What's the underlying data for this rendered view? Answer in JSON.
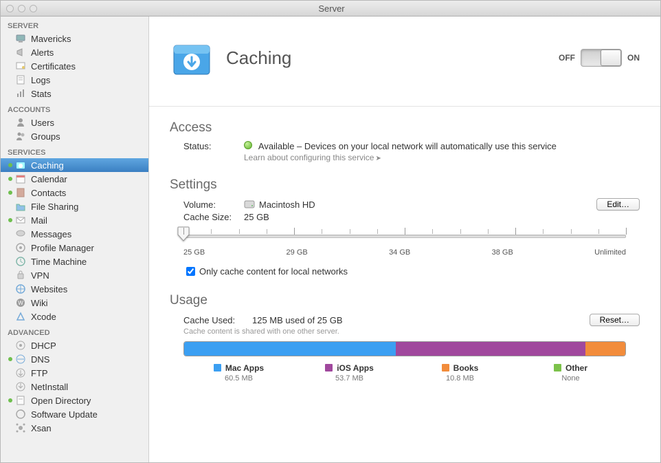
{
  "window": {
    "title": "Server"
  },
  "sidebar": {
    "sections": [
      {
        "title": "SERVER",
        "items": [
          {
            "label": "Mavericks",
            "icon": "display"
          },
          {
            "label": "Alerts",
            "icon": "megaphone"
          },
          {
            "label": "Certificates",
            "icon": "certificate"
          },
          {
            "label": "Logs",
            "icon": "log"
          },
          {
            "label": "Stats",
            "icon": "stats"
          }
        ]
      },
      {
        "title": "ACCOUNTS",
        "items": [
          {
            "label": "Users",
            "icon": "user"
          },
          {
            "label": "Groups",
            "icon": "group"
          }
        ]
      },
      {
        "title": "SERVICES",
        "items": [
          {
            "label": "Caching",
            "icon": "caching",
            "dot": true,
            "selected": true
          },
          {
            "label": "Calendar",
            "icon": "calendar",
            "dot": true
          },
          {
            "label": "Contacts",
            "icon": "contacts",
            "dot": true
          },
          {
            "label": "File Sharing",
            "icon": "folder"
          },
          {
            "label": "Mail",
            "icon": "mail",
            "dot": true
          },
          {
            "label": "Messages",
            "icon": "messages"
          },
          {
            "label": "Profile Manager",
            "icon": "profile"
          },
          {
            "label": "Time Machine",
            "icon": "timemachine"
          },
          {
            "label": "VPN",
            "icon": "vpn"
          },
          {
            "label": "Websites",
            "icon": "websites"
          },
          {
            "label": "Wiki",
            "icon": "wiki"
          },
          {
            "label": "Xcode",
            "icon": "xcode"
          }
        ]
      },
      {
        "title": "ADVANCED",
        "items": [
          {
            "label": "DHCP",
            "icon": "dhcp"
          },
          {
            "label": "DNS",
            "icon": "dns",
            "dot": true
          },
          {
            "label": "FTP",
            "icon": "ftp"
          },
          {
            "label": "NetInstall",
            "icon": "netinstall"
          },
          {
            "label": "Open Directory",
            "icon": "opendir",
            "dot": true
          },
          {
            "label": "Software Update",
            "icon": "swupdate"
          },
          {
            "label": "Xsan",
            "icon": "xsan"
          }
        ]
      }
    ]
  },
  "header": {
    "title": "Caching",
    "off_label": "OFF",
    "on_label": "ON",
    "toggle_on": true
  },
  "access": {
    "heading": "Access",
    "status_label": "Status:",
    "status_text": "Available – Devices on your local network will automatically use this service",
    "learn_text": "Learn about configuring this service"
  },
  "settings": {
    "heading": "Settings",
    "volume_label": "Volume:",
    "volume_value": "Macintosh HD",
    "edit_button": "Edit…",
    "cache_size_label": "Cache Size:",
    "cache_size_value": "25 GB",
    "slider_ticks": [
      "25 GB",
      "29 GB",
      "34 GB",
      "38 GB",
      "Unlimited"
    ],
    "checkbox_label": "Only cache content for local networks",
    "checkbox_checked": true
  },
  "usage": {
    "heading": "Usage",
    "cache_used_label": "Cache Used:",
    "cache_used_value": "125 MB used of 25 GB",
    "reset_button": "Reset…",
    "subnote": "Cache content is shared with one other server.",
    "segments": [
      {
        "name": "Mac Apps",
        "value": "60.5 MB",
        "color": "mac",
        "pct": 48
      },
      {
        "name": "iOS Apps",
        "value": "53.7 MB",
        "color": "ios",
        "pct": 43
      },
      {
        "name": "Books",
        "value": "10.8 MB",
        "color": "books",
        "pct": 9
      },
      {
        "name": "Other",
        "value": "None",
        "color": "other",
        "pct": 0
      }
    ]
  }
}
